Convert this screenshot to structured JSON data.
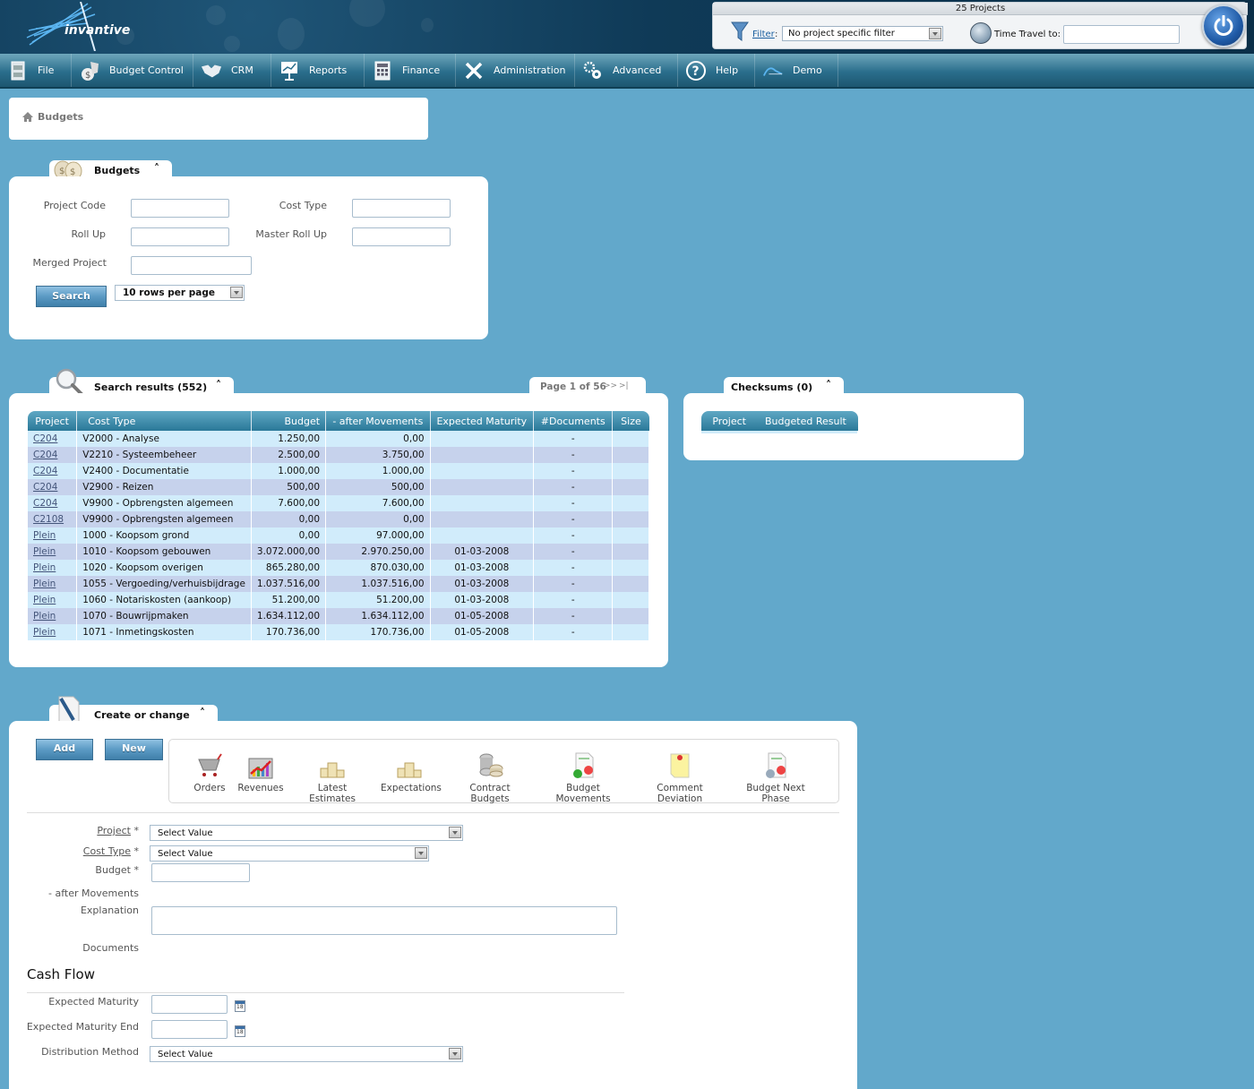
{
  "app": {
    "logo_text": "invantive"
  },
  "top_panel": {
    "project_count": "25 Projects",
    "filter_link": "Filter",
    "filter_colon": ":",
    "filter_value": "No project specific filter",
    "time_travel_label": "Time Travel to:",
    "time_travel_value": ""
  },
  "nav": [
    {
      "label": "File",
      "icon": "file-cabinet-icon"
    },
    {
      "label": "Budget Control",
      "icon": "money-bag-icon"
    },
    {
      "label": "CRM",
      "icon": "handshake-icon"
    },
    {
      "label": "Reports",
      "icon": "presentation-chart-icon"
    },
    {
      "label": "Finance",
      "icon": "calculator-icon"
    },
    {
      "label": "Administration",
      "icon": "tools-icon"
    },
    {
      "label": "Advanced",
      "icon": "gears-icon"
    },
    {
      "label": "Help",
      "icon": "help-icon"
    },
    {
      "label": "Demo",
      "icon": "demo-logo-icon"
    }
  ],
  "breadcrumb": {
    "label": "Budgets"
  },
  "search_panel": {
    "title": "Budgets",
    "fields": {
      "project_code": {
        "label": "Project Code",
        "value": ""
      },
      "cost_type": {
        "label": "Cost Type",
        "value": ""
      },
      "roll_up": {
        "label": "Roll Up",
        "value": ""
      },
      "master_roll_up": {
        "label": "Master Roll Up",
        "value": ""
      },
      "merged_project": {
        "label": "Merged Project",
        "value": ""
      }
    },
    "search_button": "Search",
    "rows_per_page": "10 rows per page"
  },
  "results": {
    "title": "Search results (552)",
    "pager": {
      "text": "Page 1 of 56",
      "next": ">>",
      "last": ">|"
    },
    "columns": [
      "Project",
      "Cost Type",
      "Budget",
      "- after Movements",
      "Expected Maturity",
      "#Documents",
      "Size"
    ],
    "rows": [
      [
        "C204",
        "V2000 - Analyse",
        "1.250,00",
        "0,00",
        "",
        "-",
        ""
      ],
      [
        "C204",
        "V2210 - Systeembeheer",
        "2.500,00",
        "3.750,00",
        "",
        "-",
        ""
      ],
      [
        "C204",
        "V2400 - Documentatie",
        "1.000,00",
        "1.000,00",
        "",
        "-",
        ""
      ],
      [
        "C204",
        "V2900 - Reizen",
        "500,00",
        "500,00",
        "",
        "-",
        ""
      ],
      [
        "C204",
        "V9900 - Opbrengsten algemeen",
        "7.600,00",
        "7.600,00",
        "",
        "-",
        ""
      ],
      [
        "C2108",
        "V9900 - Opbrengsten algemeen",
        "0,00",
        "0,00",
        "",
        "-",
        ""
      ],
      [
        "Plein",
        "1000 - Koopsom grond",
        "0,00",
        "97.000,00",
        "",
        "-",
        ""
      ],
      [
        "Plein",
        "1010 - Koopsom gebouwen",
        "3.072.000,00",
        "2.970.250,00",
        "01-03-2008",
        "-",
        ""
      ],
      [
        "Plein",
        "1020 - Koopsom overigen",
        "865.280,00",
        "870.030,00",
        "01-03-2008",
        "-",
        ""
      ],
      [
        "Plein",
        "1055 - Vergoeding/verhuisbijdrage",
        "1.037.516,00",
        "1.037.516,00",
        "01-03-2008",
        "-",
        ""
      ],
      [
        "Plein",
        "1060 - Notariskosten (aankoop)",
        "51.200,00",
        "51.200,00",
        "01-03-2008",
        "-",
        ""
      ],
      [
        "Plein",
        "1070 - Bouwrijpmaken",
        "1.634.112,00",
        "1.634.112,00",
        "01-05-2008",
        "-",
        ""
      ],
      [
        "Plein",
        "1071 - Inmetingskosten",
        "170.736,00",
        "170.736,00",
        "01-05-2008",
        "-",
        ""
      ]
    ]
  },
  "checksums": {
    "title": "Checksums (0)",
    "columns": [
      "Project",
      "Budgeted Result"
    ]
  },
  "create": {
    "title": "Create or change",
    "add_button": "Add",
    "new_button": "New",
    "actions": [
      {
        "label": "Orders",
        "icon": "shopping-cart-icon"
      },
      {
        "label": "Revenues",
        "icon": "revenue-chart-icon"
      },
      {
        "label": "Latest Estimates",
        "icon": "podium-icon"
      },
      {
        "label": "Expectations",
        "icon": "podium-icon"
      },
      {
        "label": "Contract Budgets",
        "icon": "coins-icon"
      },
      {
        "label": "Budget Movements",
        "icon": "report-movement-icon"
      },
      {
        "label": "Comment Deviation",
        "icon": "sticky-note-icon"
      },
      {
        "label": "Budget Next Phase",
        "icon": "report-next-phase-icon"
      }
    ],
    "form": {
      "project_label": "Project",
      "project_value": "Select Value",
      "cost_type_label": "Cost Type",
      "cost_type_value": "Select Value",
      "budget_label": "Budget",
      "required_marker": "*",
      "after_movements_label": "- after Movements",
      "explanation_label": "Explanation",
      "documents_label": "Documents"
    },
    "cash_flow": {
      "heading": "Cash Flow",
      "expected_maturity_label": "Expected Maturity",
      "expected_maturity_end_label": "Expected Maturity End",
      "distribution_method_label": "Distribution Method",
      "distribution_method_value": "Select Value",
      "calendar_day": "18"
    }
  }
}
